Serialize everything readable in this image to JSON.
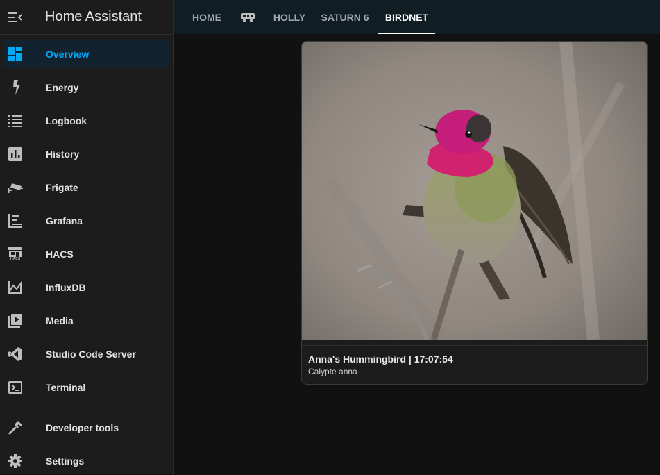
{
  "app": {
    "title": "Home Assistant"
  },
  "sidebar": {
    "items": [
      {
        "label": "Overview",
        "icon": "overview-icon",
        "active": true
      },
      {
        "label": "Energy",
        "icon": "lightning-icon"
      },
      {
        "label": "Logbook",
        "icon": "logbook-icon"
      },
      {
        "label": "History",
        "icon": "history-chart-icon"
      },
      {
        "label": "Frigate",
        "icon": "cctv-icon"
      },
      {
        "label": "Grafana",
        "icon": "grafana-icon"
      },
      {
        "label": "HACS",
        "icon": "hacs-store-icon"
      },
      {
        "label": "InfluxDB",
        "icon": "area-chart-icon"
      },
      {
        "label": "Media",
        "icon": "media-play-icon"
      },
      {
        "label": "Studio Code Server",
        "icon": "vscode-icon"
      },
      {
        "label": "Terminal",
        "icon": "terminal-icon"
      },
      {
        "label": "Developer tools",
        "icon": "hammer-icon"
      },
      {
        "label": "Settings",
        "icon": "gear-icon"
      }
    ],
    "hacs_icon_text": "HACS"
  },
  "tabs": [
    {
      "label": "HOME"
    },
    {
      "label": "",
      "icon": "rv-icon"
    },
    {
      "label": "HOLLY"
    },
    {
      "label": "SATURN 6"
    },
    {
      "label": "BIRDNET",
      "active": true
    }
  ],
  "card": {
    "title": "Anna's Hummingbird | 17:07:54",
    "subtitle": "Calypte anna"
  },
  "colors": {
    "accent": "#03a9f4",
    "sidebar_bg": "#1c1c1c",
    "topbar_bg": "#101e24",
    "page_bg": "#111111"
  }
}
